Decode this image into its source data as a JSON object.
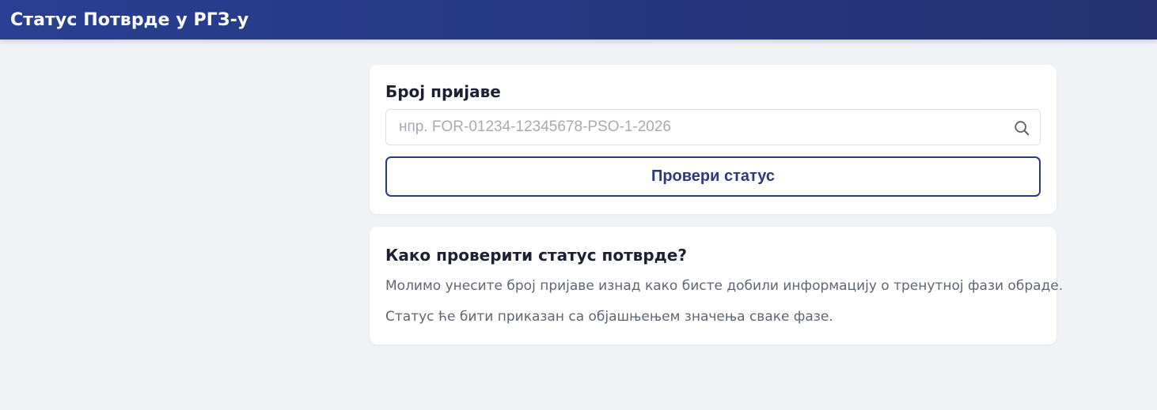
{
  "header": {
    "title": "Статус Потврде у РГЗ-у"
  },
  "search": {
    "label": "Број пријаве",
    "placeholder": "нпр. FOR-01234-12345678-PSO-1-2026",
    "value": "",
    "search_icon": "search-icon",
    "button_label": "Провери статус"
  },
  "info": {
    "title": "Како проверити статус потврде?",
    "paragraphs": [
      "Молимо унесите број пријаве изнад како бисте добили информацију о тренутној фази обраде.",
      "Статус ће бити приказан са објашњењем значења сваке фазе."
    ]
  },
  "colors": {
    "header_bg": "#2a3f93",
    "accent": "#2b3b7a",
    "page_bg": "#f1f2f6"
  }
}
